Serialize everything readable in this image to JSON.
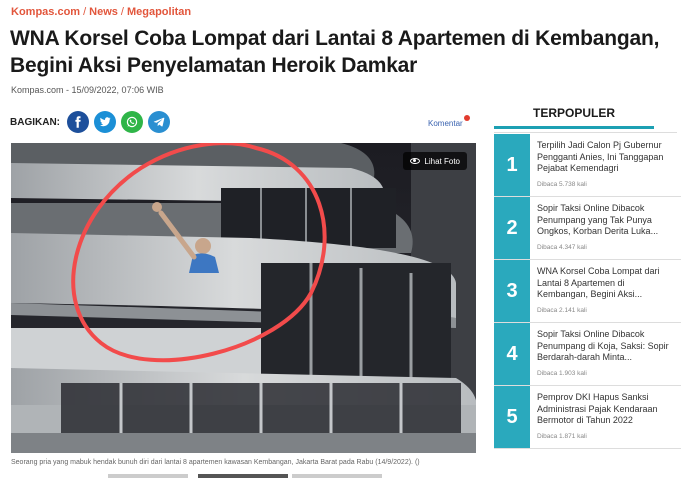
{
  "breadcrumb": {
    "site": "Kompas.com",
    "section": "News",
    "subsection": "Megapolitan",
    "separator": "/"
  },
  "article": {
    "title": "WNA Korsel Coba Lompat dari Lantai 8 Apartemen di Kembangan, Begini Aksi Penyelamatan Heroik Damkar",
    "meta": "Kompas.com - 15/09/2022, 07:06 WIB",
    "share_label": "BAGIKAN:",
    "komentar": "Komentar",
    "lihat_foto": "Lihat Foto",
    "caption": "Seorang pria yang mabuk hendak bunuh diri dari lantai 8 apartemen kawasan Kembangan, Jakarta Barat pada Rabu (14/9/2022).",
    "caption_suffix": "()"
  },
  "share_icons": [
    "facebook-icon",
    "twitter-icon",
    "whatsapp-icon",
    "telegram-icon"
  ],
  "colors": {
    "accent": "#e2563c",
    "teal": "#2aa9bd",
    "facebook": "#1d4f9b",
    "twitter": "#1b8fd6",
    "whatsapp": "#2fb548",
    "telegram": "#2a8fd1"
  },
  "sidebar": {
    "title": "TERPOPULER",
    "items": [
      {
        "num": "1",
        "text": "Terpilih Jadi Calon Pj Gubernur Pengganti Anies, Ini Tanggapan Pejabat Kemendagri",
        "reads": "Dibaca 5.738 kali"
      },
      {
        "num": "2",
        "text": "Sopir Taksi Online Dibacok Penumpang yang Tak Punya Ongkos, Korban Derita Luka...",
        "reads": "Dibaca 4.347 kali"
      },
      {
        "num": "3",
        "text": "WNA Korsel Coba Lompat dari Lantai 8 Apartemen di Kembangan, Begini Aksi...",
        "reads": "Dibaca 2.141 kali"
      },
      {
        "num": "4",
        "text": "Sopir Taksi Online Dibacok Penumpang di Koja, Saksi: Sopir Berdarah-darah Minta...",
        "reads": "Dibaca 1.903 kali"
      },
      {
        "num": "5",
        "text": "Pemprov DKI Hapus Sanksi Administrasi Pajak Kendaraan Bermotor di Tahun 2022",
        "reads": "Dibaca 1.871 kali"
      }
    ]
  }
}
